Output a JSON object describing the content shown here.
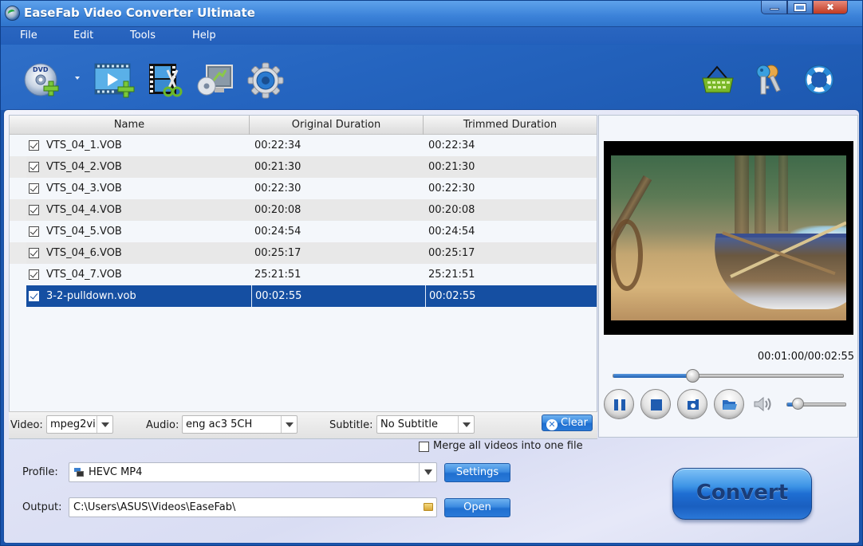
{
  "window": {
    "title": "EaseFab Video Converter Ultimate",
    "controls": [
      "minimize",
      "maximize",
      "close"
    ]
  },
  "menu": {
    "items": [
      {
        "label": "File"
      },
      {
        "label": "Edit"
      },
      {
        "label": "Tools"
      },
      {
        "label": "Help"
      }
    ]
  },
  "toolbar": {
    "left": [
      {
        "icon": "load-disc-icon",
        "tooltip": "Load Disc"
      },
      {
        "icon": "add-video-icon",
        "tooltip": "Add Video"
      },
      {
        "icon": "edit-video-icon",
        "tooltip": "Edit"
      },
      {
        "icon": "merge-disc-icon",
        "tooltip": "Disc/Media"
      },
      {
        "icon": "settings-gear-icon",
        "tooltip": "Options"
      }
    ],
    "right": [
      {
        "icon": "shopping-basket-icon",
        "tooltip": "Buy"
      },
      {
        "icon": "keys-icon",
        "tooltip": "Register"
      },
      {
        "icon": "lifebuoy-icon",
        "tooltip": "Help"
      }
    ]
  },
  "file_list": {
    "columns": [
      "Name",
      "Original Duration",
      "Trimmed Duration"
    ],
    "rows": [
      {
        "checked": true,
        "name": "VTS_04_1.VOB",
        "original": "00:22:34",
        "trimmed": "00:22:34",
        "selected": false
      },
      {
        "checked": true,
        "name": "VTS_04_2.VOB",
        "original": "00:21:30",
        "trimmed": "00:21:30",
        "selected": false
      },
      {
        "checked": true,
        "name": "VTS_04_3.VOB",
        "original": "00:22:30",
        "trimmed": "00:22:30",
        "selected": false
      },
      {
        "checked": true,
        "name": "VTS_04_4.VOB",
        "original": "00:20:08",
        "trimmed": "00:20:08",
        "selected": false
      },
      {
        "checked": true,
        "name": "VTS_04_5.VOB",
        "original": "00:24:54",
        "trimmed": "00:24:54",
        "selected": false
      },
      {
        "checked": true,
        "name": "VTS_04_6.VOB",
        "original": "00:25:17",
        "trimmed": "00:25:17",
        "selected": false
      },
      {
        "checked": true,
        "name": "VTS_04_7.VOB",
        "original": "25:21:51",
        "trimmed": "25:21:51",
        "selected": false
      },
      {
        "checked": true,
        "name": "3-2-pulldown.vob",
        "original": "00:02:55",
        "trimmed": "00:02:55",
        "selected": true
      }
    ]
  },
  "streams": {
    "video_label": "Video:",
    "video_value": "mpeg2vi",
    "audio_label": "Audio:",
    "audio_value": "eng ac3 5CH",
    "subtitle_label": "Subtitle:",
    "subtitle_value": "No Subtitle",
    "clear_label": "Clear"
  },
  "merge": {
    "label": "Merge all videos into one file",
    "checked": false
  },
  "preview": {
    "time": "00:01:00/00:02:55",
    "progress": 0.34,
    "volume": 0.17,
    "buttons": [
      "pause",
      "stop",
      "snapshot",
      "open-folder"
    ]
  },
  "output": {
    "profile_label": "Profile:",
    "profile_value": "HEVC MP4",
    "settings_label": "Settings",
    "output_label": "Output:",
    "output_value": "C:\\Users\\ASUS\\Videos\\EaseFab\\",
    "open_label": "Open",
    "convert_label": "Convert"
  },
  "colors": {
    "selected_row": "#154fa2",
    "window_blue": "#1b55ad",
    "button_blue": "#2a7ad8"
  }
}
